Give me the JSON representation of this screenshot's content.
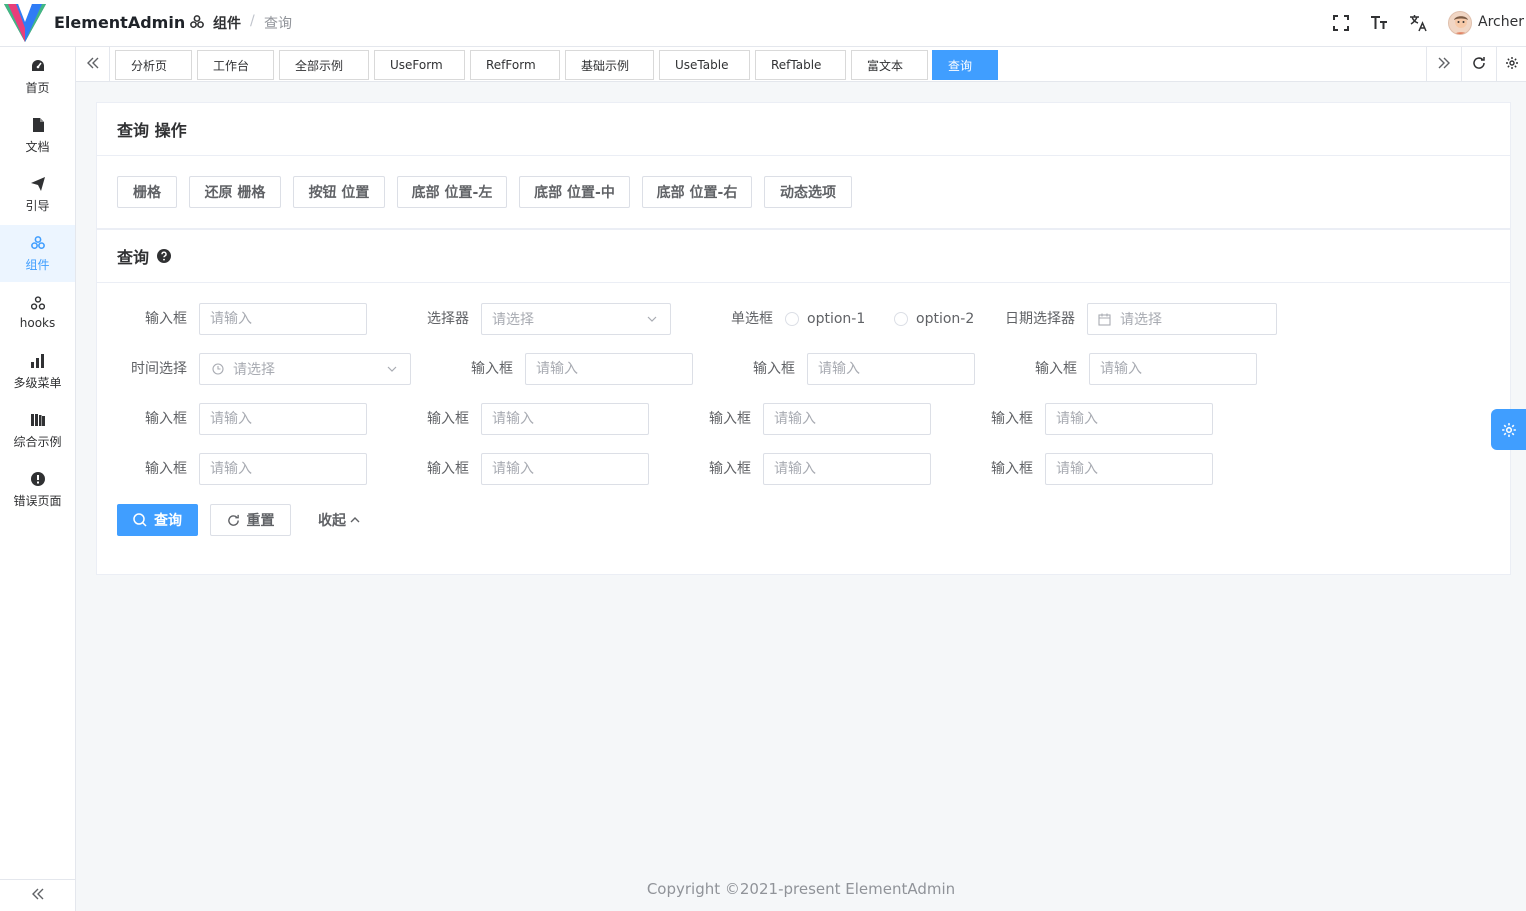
{
  "app": {
    "title": "ElementAdmin"
  },
  "breadcrumb": {
    "parent": "组件",
    "separator": "/",
    "current": "查询"
  },
  "header": {
    "user_name": "Archer"
  },
  "sidebar": {
    "items": [
      {
        "label": "首页",
        "icon": "dashboard-icon"
      },
      {
        "label": "文档",
        "icon": "document-icon"
      },
      {
        "label": "引导",
        "icon": "send-icon"
      },
      {
        "label": "组件",
        "icon": "component-icon",
        "active": true
      },
      {
        "label": "hooks",
        "icon": "hooks-icon"
      },
      {
        "label": "多级菜单",
        "icon": "chart-bar-icon"
      },
      {
        "label": "综合示例",
        "icon": "library-icon"
      },
      {
        "label": "错误页面",
        "icon": "error-icon"
      }
    ]
  },
  "tags": [
    "分析页",
    "工作台",
    "全部示例",
    "UseForm",
    "RefForm",
    "基础示例",
    "UseTable",
    "RefTable",
    "富文本",
    "查询"
  ],
  "ops_card": {
    "title": "查询 操作",
    "buttons": [
      "栅格",
      "还原 栅格",
      "按钮 位置",
      "底部 位置-左",
      "底部 位置-中",
      "底部 位置-右",
      "动态选项"
    ]
  },
  "search_card": {
    "title": "查询",
    "labels": {
      "input": "输入框",
      "select": "选择器",
      "radio": "单选框",
      "date": "日期选择器",
      "time": "时间选择"
    },
    "placeholders": {
      "input": "请输入",
      "select": "请选择"
    },
    "radio_options": [
      "option-1",
      "option-2"
    ],
    "buttons": {
      "query": "查询",
      "reset": "重置",
      "collapse": "收起"
    }
  },
  "footer": {
    "copyright": "Copyright ©2021-present ElementAdmin"
  },
  "colors": {
    "primary": "#409eff",
    "active_bg": "#ecf5ff",
    "border": "#dcdfe6"
  }
}
